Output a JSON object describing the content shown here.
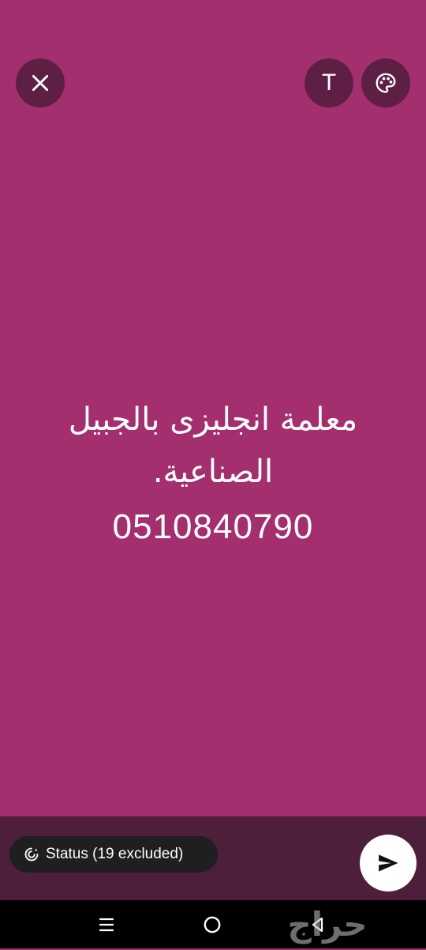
{
  "toolbar": {
    "close_icon": "close-icon",
    "text_tool_label": "T",
    "palette_icon": "palette-icon"
  },
  "status_text": {
    "line1": "معلمة انجليزى بالجبيل",
    "line2": "الصناعية.",
    "phone": "0510840790"
  },
  "bottom": {
    "audience_label": "Status (19 excluded)",
    "audience_icon": "status-ring-icon",
    "send_icon": "send-icon"
  },
  "nav": {
    "recents_icon": "recents-icon",
    "home_icon": "home-icon",
    "back_icon": "back-icon"
  },
  "watermark": {
    "text": "حراج"
  },
  "colors": {
    "background": "#a42f6e",
    "toolbar_button": "#5e1f44",
    "bottom_panel": "#4d1f3b",
    "chip": "#1f1f22",
    "text": "#ffffff"
  }
}
